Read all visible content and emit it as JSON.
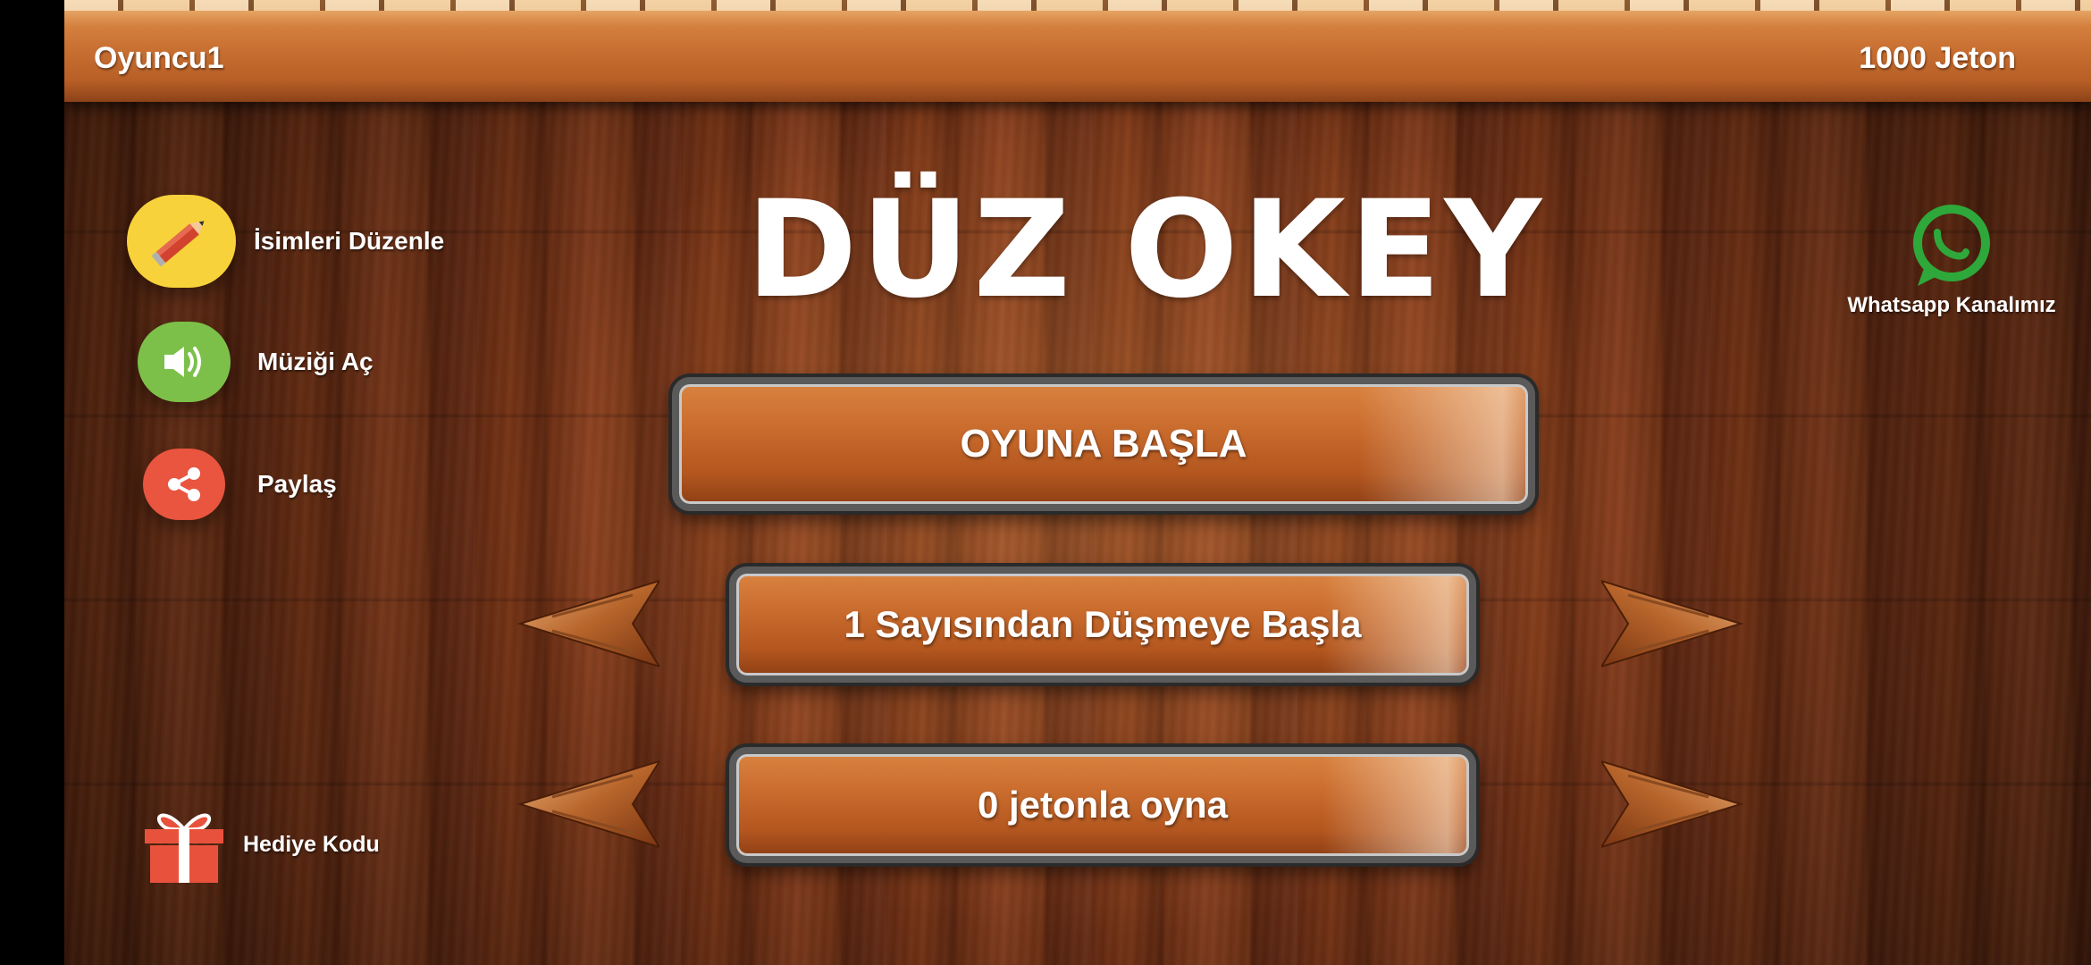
{
  "header": {
    "player_name": "Oyuncu1",
    "coins": "1000 Jeton"
  },
  "title": "DÜZ OKEY",
  "side_menu": {
    "edit_names": "İsimleri Düzenle",
    "music": "Müziği Aç",
    "share": "Paylaş",
    "gift_code": "Hediye Kodu"
  },
  "whatsapp": {
    "label": "Whatsapp Kanalımız"
  },
  "buttons": {
    "start_game": "OYUNA BAŞLA",
    "start_number": "1 Sayısından Düşmeye Başla",
    "play_mode": "0 jetonla oyna"
  },
  "icons": {
    "edit": "pencil-icon",
    "music": "speaker-icon",
    "share": "share-icon",
    "gift": "gift-icon",
    "whatsapp": "whatsapp-icon",
    "prev": "arrow-left-icon",
    "next": "arrow-right-icon"
  },
  "colors": {
    "edit_icon_bg": "#f7d23a",
    "music_icon_bg": "#7cc04a",
    "share_icon_bg": "#e9553f",
    "gift": "#e8523c",
    "whatsapp": "#2ea83a"
  }
}
